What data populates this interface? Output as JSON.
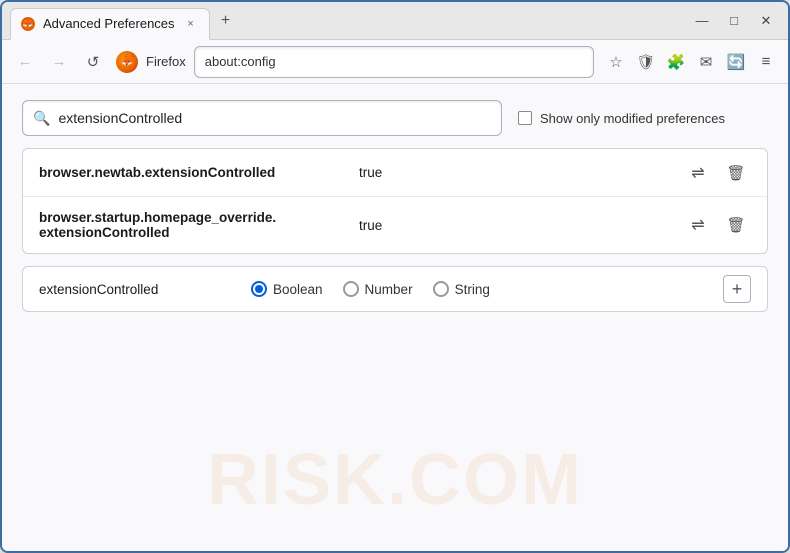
{
  "window": {
    "title": "Advanced Preferences",
    "tab_favicon": "🦊",
    "tab_close": "×",
    "new_tab_btn": "+",
    "win_minimize": "—",
    "win_maximize": "□",
    "win_close": "✕"
  },
  "navbar": {
    "back_arrow": "←",
    "forward_arrow": "→",
    "reload": "↺",
    "firefox_label": "Firefox",
    "address": "about:config",
    "bookmark_icon": "☆",
    "shield_icon": "🛡",
    "addon_icon": "🧩",
    "mail_icon": "✉",
    "sync_icon": "🔄",
    "menu_icon": "≡"
  },
  "search": {
    "placeholder": "extensionControlled",
    "checkbox_label": "Show only modified preferences"
  },
  "results": {
    "rows": [
      {
        "name": "browser.newtab.extensionControlled",
        "value": "true",
        "multiline": false
      },
      {
        "name_line1": "browser.startup.homepage_override.",
        "name_line2": "extensionControlled",
        "value": "true",
        "multiline": true
      }
    ]
  },
  "add_preference": {
    "name": "extensionControlled",
    "type_boolean": "Boolean",
    "type_number": "Number",
    "type_string": "String",
    "add_btn": "+"
  },
  "watermark": "RISK.COM"
}
